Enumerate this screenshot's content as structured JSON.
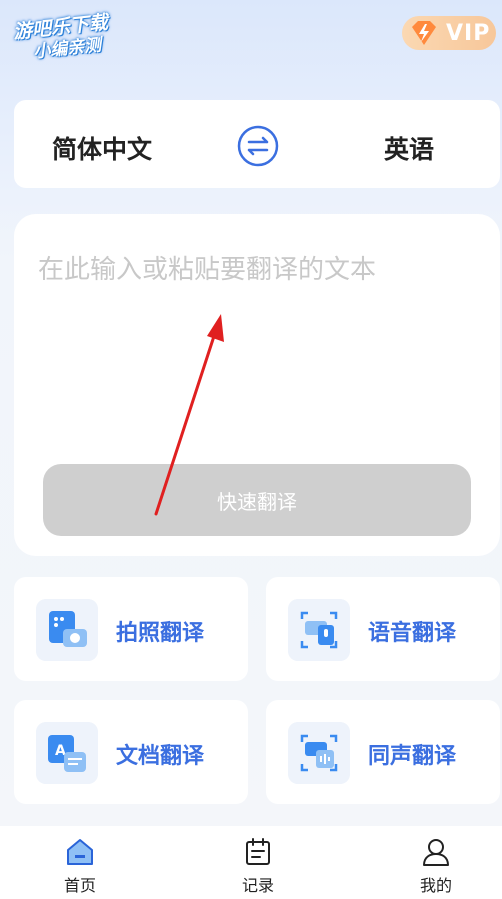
{
  "watermark": {
    "line1": "游吧乐下载",
    "line2": "小编亲测"
  },
  "vip": {
    "label": "VIP"
  },
  "language": {
    "source": "简体中文",
    "target": "英语"
  },
  "input": {
    "placeholder": "在此输入或粘贴要翻译的文本",
    "value": ""
  },
  "translate_button": {
    "label": "快速翻译"
  },
  "features": [
    {
      "label": "拍照翻译",
      "icon": "camera-icon"
    },
    {
      "label": "语音翻译",
      "icon": "microphone-icon"
    },
    {
      "label": "文档翻译",
      "icon": "document-icon"
    },
    {
      "label": "同声翻译",
      "icon": "simultaneous-icon"
    }
  ],
  "nav": [
    {
      "label": "首页",
      "icon": "home-icon",
      "active": true
    },
    {
      "label": "记录",
      "icon": "calendar-icon",
      "active": false
    },
    {
      "label": "我的",
      "icon": "user-icon",
      "active": false
    }
  ],
  "colors": {
    "accent": "#3b6fe0",
    "button_disabled": "#cfcfcf",
    "vip_gold": "#f7c79a",
    "annotation_arrow": "#e02020"
  }
}
